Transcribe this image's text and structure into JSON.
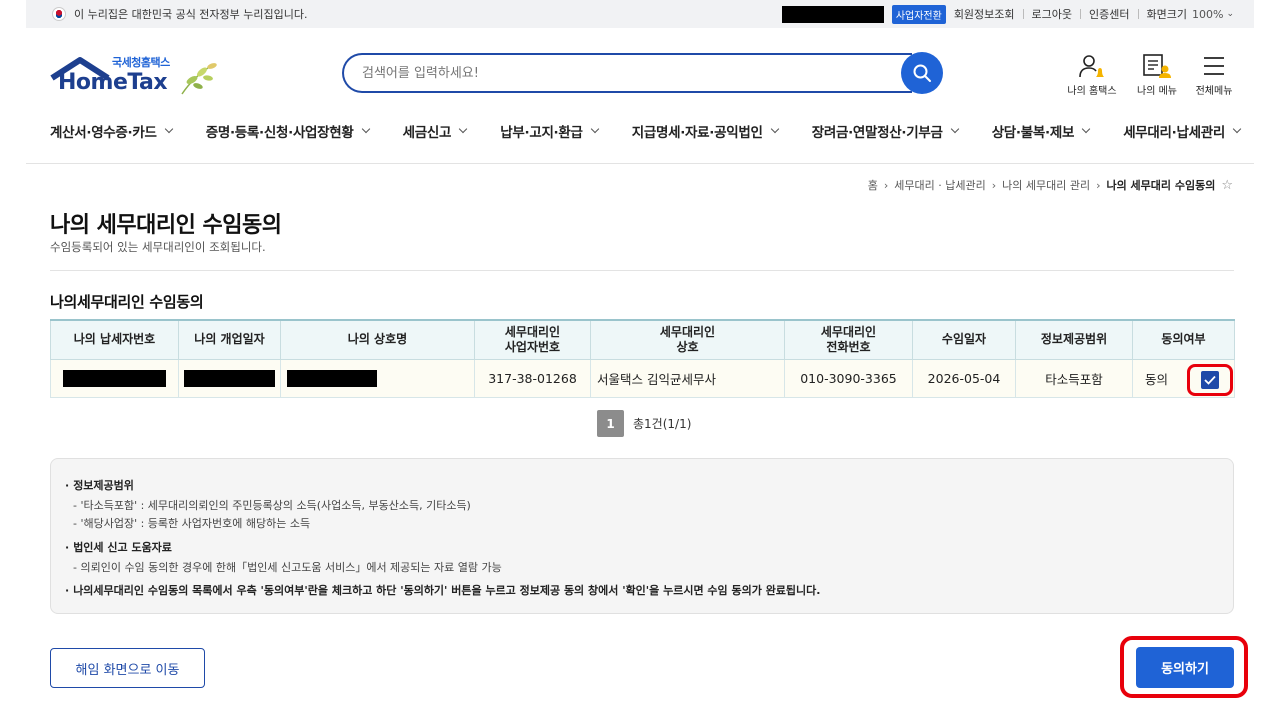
{
  "gov_bar": {
    "notice": "이 누리집은 대한민국 공식 전자정부 누리집입니다.",
    "biz_switch": "사업자전환",
    "member_info": "회원정보조회",
    "logout": "로그아웃",
    "cert_center": "인증센터",
    "screen_size": "화면크기",
    "zoom": "100%"
  },
  "logo": {
    "sub": "국세청홈택스",
    "main": "HomeTax"
  },
  "search": {
    "placeholder": "검색어를 입력하세요!"
  },
  "header_icons": {
    "my_hometax": "나의 홈택스",
    "my_menu": "나의 메뉴",
    "all_menu": "전체메뉴"
  },
  "nav": [
    "계산서·영수증·카드",
    "증명·등록·신청·사업장현황",
    "세금신고",
    "납부·고지·환급",
    "지급명세·자료·공익법인",
    "장려금·연말정산·기부금",
    "상담·불복·제보",
    "세무대리·납세관리"
  ],
  "breadcrumb": [
    "홈",
    "세무대리 · 납세관리",
    "나의 세무대리 관리",
    "나의 세무대리 수임동의"
  ],
  "page": {
    "title": "나의 세무대리인 수임동의",
    "desc": "수임등록되어 있는 세무대리인이 조회됩니다.",
    "section_title": "나의세무대리인 수임동의"
  },
  "table": {
    "headers": {
      "tin": "나의 납세자번호",
      "open_date": "나의 개업일자",
      "biz_name": "나의 상호명",
      "agent_brn_1": "세무대리인",
      "agent_brn_2": "사업자번호",
      "agent_name_1": "세무대리인",
      "agent_name_2": "상호",
      "agent_tel_1": "세무대리인",
      "agent_tel_2": "전화번호",
      "date": "수임일자",
      "scope": "정보제공범위",
      "consent": "동의여부"
    },
    "row": {
      "agent_brn": "317-38-01268",
      "agent_name": "서울택스 김익균세무사",
      "agent_tel": "010-3090-3365",
      "date": "2026-05-04",
      "scope": "타소득포함",
      "consent": "동의"
    }
  },
  "pager": {
    "page": "1",
    "total": "총1건(1/1)"
  },
  "info": {
    "h1": "정보제공범위",
    "l1": "- '타소득포함' : 세무대리의뢰인의 주민등록상의 소득(사업소득, 부동산소득, 기타소득)",
    "l2": "- '해당사업장' : 등록한 사업자번호에 해당하는 소득",
    "h2": "법인세 신고 도움자료",
    "l3": "- 의뢰인이 수임 동의한 경우에 한해「법인세 신고도움 서비스」에서 제공되는 자료 열람 가능",
    "h3": "나의세무대리인 수임동의 목록에서 우측 '동의여부'란을 체크하고 하단 '동의하기' 버튼을 누르고 정보제공 동의 창에서 '확인'을 누르시면 수임 동의가 완료됩니다."
  },
  "buttons": {
    "dismiss": "해임 화면으로 이동",
    "agree": "동의하기"
  },
  "colors": {
    "primary": "#1f63d6",
    "navy": "#1f4aa8",
    "highlight": "#e8000b"
  }
}
